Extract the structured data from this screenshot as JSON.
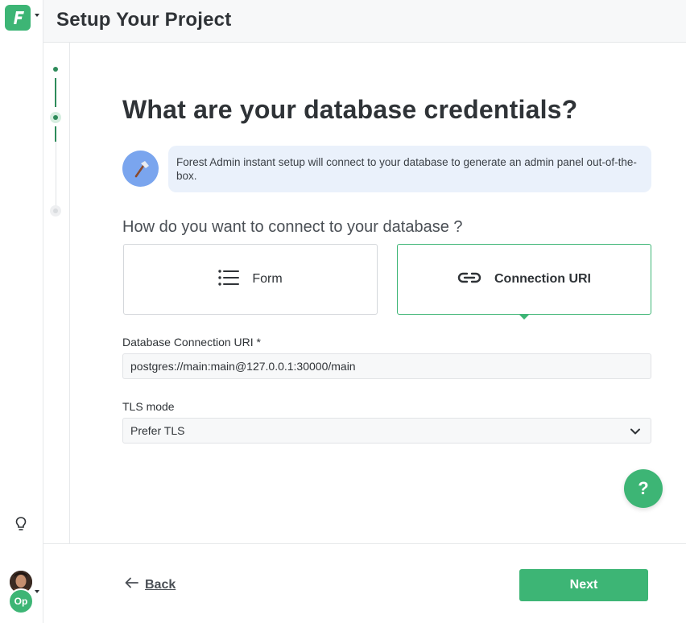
{
  "header": {
    "title": "Setup Your Project"
  },
  "sidebar": {
    "avatar_badge": "Op"
  },
  "stepper": {
    "steps": [
      "done",
      "current",
      "pending"
    ]
  },
  "main": {
    "title": "What are your database credentials?",
    "info_text": "Forest Admin instant setup will connect to your database to generate an admin panel out-of-the-box.",
    "question": "How do you want to connect to your database ?",
    "options": [
      {
        "label": "Form",
        "icon": "list-icon",
        "selected": false
      },
      {
        "label": "Connection URI",
        "icon": "link-icon",
        "selected": true
      }
    ],
    "uri_label": "Database Connection URI *",
    "uri_value": "postgres://main:main@127.0.0.1:30000/main",
    "tls_label": "TLS mode",
    "tls_value": "Prefer TLS",
    "help_label": "?"
  },
  "footer": {
    "back_label": "Back",
    "next_label": "Next"
  },
  "colors": {
    "accent": "#3db575",
    "info_bg": "#eaf1fb",
    "info_icon": "#7aa5ee"
  }
}
